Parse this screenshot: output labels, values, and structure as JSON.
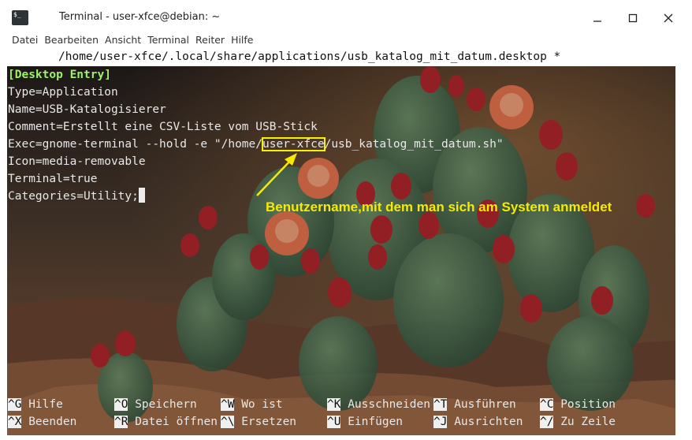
{
  "window": {
    "title": "Terminal - user-xfce@debian: ~",
    "icon": "terminal-icon",
    "icon_text": "$_"
  },
  "menu": [
    "Datei",
    "Bearbeiten",
    "Ansicht",
    "Terminal",
    "Reiter",
    "Hilfe"
  ],
  "editor": {
    "filename_line": "/home/user-xfce/.local/share/applications/usb_katalog_mit_datum.desktop *",
    "lines": [
      "[Desktop Entry]",
      "Type=Application",
      "Name=USB-Katalogisierer",
      "Comment=Erstellt eine CSV-Liste vom USB-Stick",
      "Exec=gnome-terminal --hold -e \"/home/",
      "user-xfce",
      "/usb_katalog_mit_datum.sh\"",
      "Icon=media-removable",
      "Terminal=true",
      "Categories=Utility;"
    ]
  },
  "annotation": {
    "text": "Benutzername,mit dem man sich am System anmeldet",
    "color": "#f5ea00"
  },
  "shortcuts": [
    [
      {
        "key": "^G",
        "label": "Hilfe"
      },
      {
        "key": "^O",
        "label": "Speichern"
      },
      {
        "key": "^W",
        "label": "Wo ist"
      },
      {
        "key": "^K",
        "label": "Ausschneiden"
      },
      {
        "key": "^T",
        "label": "Ausführen"
      },
      {
        "key": "^C",
        "label": "Position"
      }
    ],
    [
      {
        "key": "^X",
        "label": "Beenden"
      },
      {
        "key": "^R",
        "label": "Datei öffnen"
      },
      {
        "key": "^\\",
        "label": "Ersetzen"
      },
      {
        "key": "^U",
        "label": "Einfügen"
      },
      {
        "key": "^J",
        "label": "Ausrichten"
      },
      {
        "key": "^/",
        "label": "Zu Zeile"
      }
    ]
  ]
}
